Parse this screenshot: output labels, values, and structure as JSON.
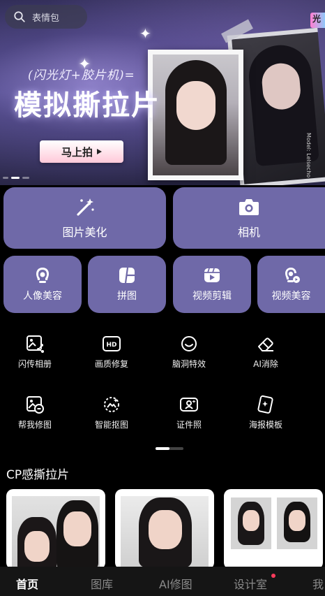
{
  "search": {
    "placeholder": "表情包"
  },
  "banner": {
    "subtitle": "(闪光灯+胶片机)=",
    "title": "模拟撕拉片",
    "cta_label": "马上拍",
    "side_text": "Model: Lelsecho",
    "corner_badge": "光"
  },
  "features_large": [
    {
      "label": "图片美化",
      "icon": "magic-wand-icon"
    },
    {
      "label": "相机",
      "icon": "camera-icon"
    }
  ],
  "features_small": [
    {
      "label": "人像美容",
      "icon": "portrait-icon"
    },
    {
      "label": "拼图",
      "icon": "collage-icon"
    },
    {
      "label": "视频剪辑",
      "icon": "video-edit-icon"
    },
    {
      "label": "视频美容",
      "icon": "video-beauty-icon"
    }
  ],
  "tools": [
    {
      "label": "闪传相册",
      "icon": "share-album-icon"
    },
    {
      "label": "画质修复",
      "icon": "hd-icon"
    },
    {
      "label": "脑洞特效",
      "icon": "smile-icon"
    },
    {
      "label": "AI消除",
      "icon": "eraser-icon"
    },
    {
      "label": "帮我修图",
      "icon": "photo-edit-icon"
    },
    {
      "label": "智能抠图",
      "icon": "cutout-icon"
    },
    {
      "label": "证件照",
      "icon": "id-photo-icon"
    },
    {
      "label": "海报模板",
      "icon": "poster-icon"
    }
  ],
  "section": {
    "title": "CP感撕拉片"
  },
  "nav": {
    "items": [
      "首页",
      "图库",
      "AI修图",
      "设计室",
      "我"
    ],
    "active_index": 0
  },
  "colors": {
    "tile": "#6f69a8",
    "nav_bg": "#151515",
    "badge_dot": "#ff3b5c"
  }
}
